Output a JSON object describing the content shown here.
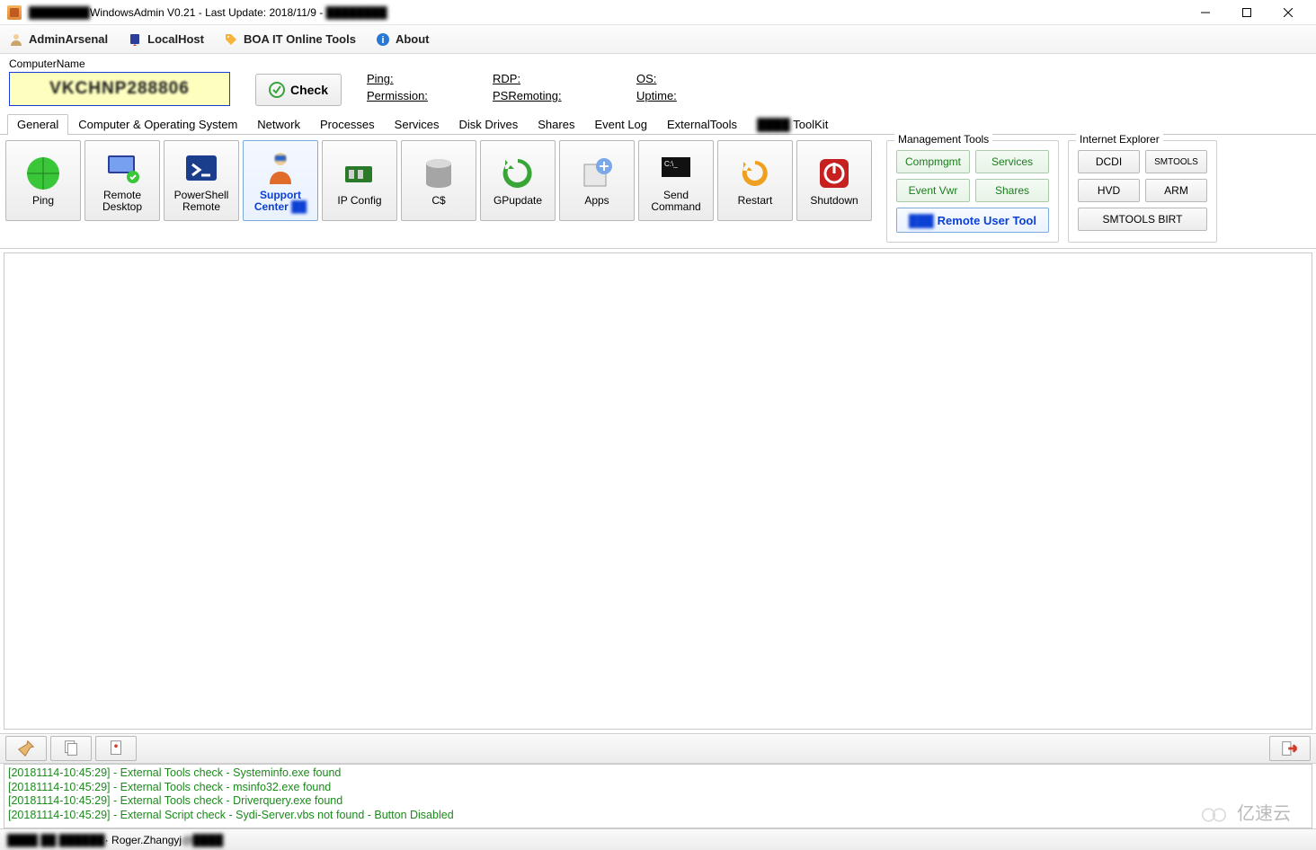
{
  "title": {
    "prefix_blur": "████████",
    "main": "WindowsAdmin V0.21 - Last Update: 2018/11/9 - ",
    "suffix_blur": "████████"
  },
  "menu": [
    {
      "icon": "admin",
      "label": "AdminArsenal"
    },
    {
      "icon": "local",
      "label": "LocalHost"
    },
    {
      "icon": "boa",
      "label": "BOA IT Online Tools"
    },
    {
      "icon": "about",
      "label": "About"
    }
  ],
  "computer": {
    "label": "ComputerName",
    "value_blur": "VKCHNP288806",
    "check": "Check"
  },
  "status": {
    "ping": "Ping:",
    "permission": "Permission:",
    "rdp": "RDP:",
    "psremoting": "PSRemoting:",
    "os": "OS:",
    "uptime": "Uptime:"
  },
  "tabs": [
    "General",
    "Computer & Operating System",
    "Network",
    "Processes",
    "Services",
    "Disk Drives",
    "Shares",
    "Event Log",
    "ExternalTools",
    "████ ToolKit"
  ],
  "active_tab": 0,
  "buttons": [
    {
      "id": "ping",
      "label": "Ping"
    },
    {
      "id": "rdp",
      "label": "Remote\nDesktop"
    },
    {
      "id": "psremote",
      "label": "PowerShell\nRemote"
    },
    {
      "id": "support",
      "label": "Support\nCenter ██",
      "selected": true
    },
    {
      "id": "ipconfig",
      "label": "IP Config"
    },
    {
      "id": "cshare",
      "label": "C$"
    },
    {
      "id": "gpupdate",
      "label": "GPupdate"
    },
    {
      "id": "apps",
      "label": "Apps"
    },
    {
      "id": "sendcmd",
      "label": "Send\nCommand"
    },
    {
      "id": "restart",
      "label": "Restart"
    },
    {
      "id": "shutdown",
      "label": "Shutdown"
    }
  ],
  "mgmt": {
    "title": "Management Tools",
    "items": [
      "Compmgmt",
      "Services",
      "Event Vwr",
      "Shares"
    ],
    "wide_prefix_blur": "███",
    "wide": "Remote User Tool"
  },
  "ie": {
    "title": "Internet Explorer",
    "items": [
      "DCDI",
      "SMTOOLS",
      "HVD",
      "ARM",
      "SMTOOLS BIRT"
    ]
  },
  "log": [
    "[20181114-10:45:29] - External Tools check - Systeminfo.exe found",
    "[20181114-10:45:29] - External Tools check - msinfo32.exe found",
    "[20181114-10:45:29] - External Tools check - Driverquery.exe found",
    "[20181114-10:45:29] - External Script check - Sydi-Server.vbs not found - Button Disabled"
  ],
  "statusbar": {
    "prefix_blur": "████ ██ ██████",
    "user": " · Roger.Zhangyj",
    "suffix_blur": "@████"
  },
  "watermark": "亿速云"
}
